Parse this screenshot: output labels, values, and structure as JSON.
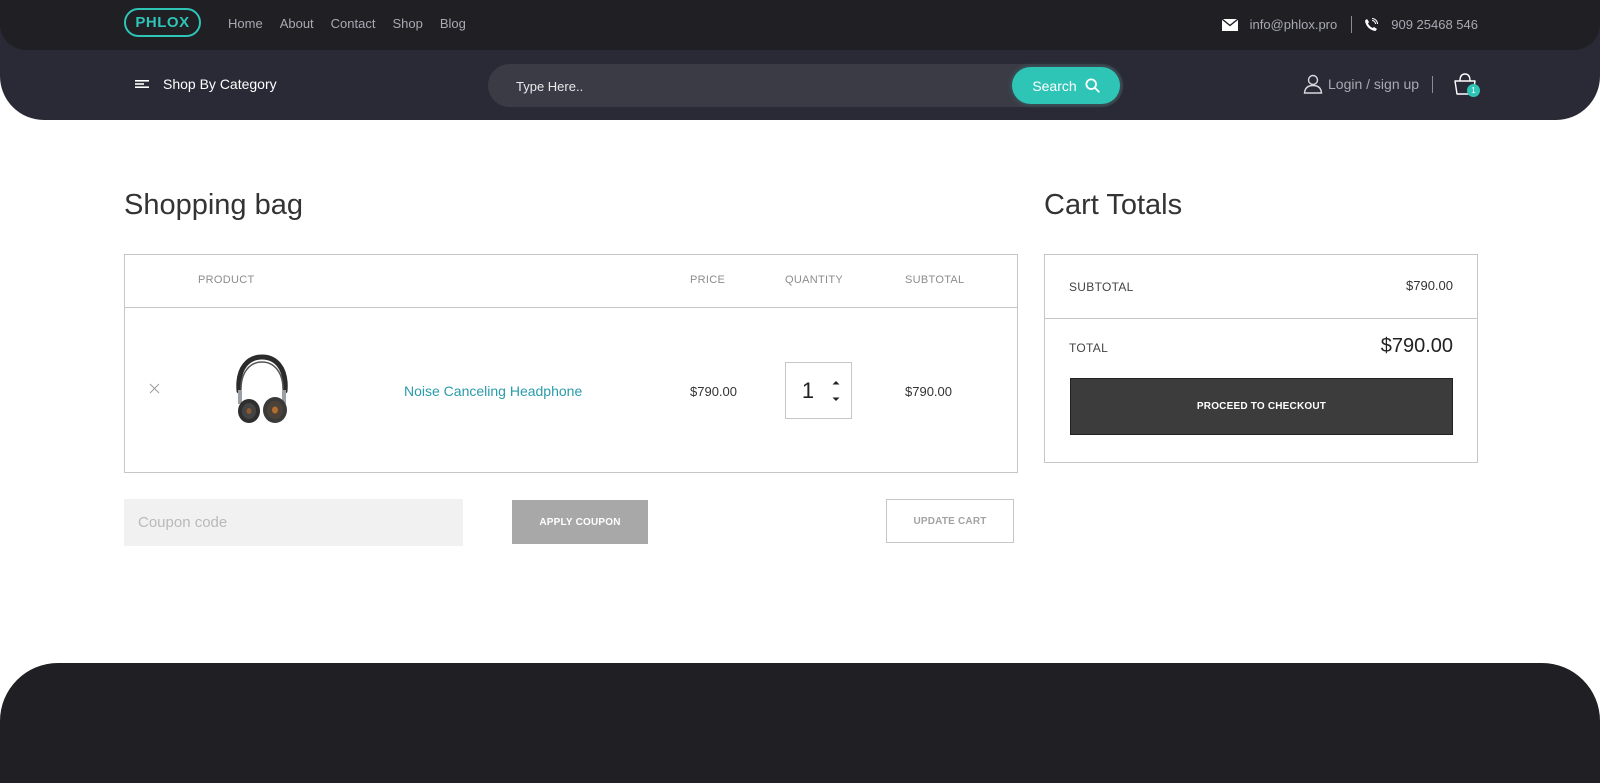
{
  "colors": {
    "accent": "#2ec4b6",
    "header_bg": "#2a2a36",
    "topbar_bg": "#1f1f24",
    "link": "#2a9bab",
    "checkout_bg": "#3c3c3c"
  },
  "header": {
    "logo": "PHLOX",
    "nav": [
      "Home",
      "About",
      "Contact",
      "Shop",
      "Blog"
    ],
    "email": "info@phlox.pro",
    "phone": "909 25468 546",
    "category_label": "Shop By Category",
    "search_placeholder": "Type Here..",
    "search_button": "Search",
    "login_label": "Login / sign up",
    "cart_count": "1"
  },
  "bag": {
    "title": "Shopping bag",
    "columns": {
      "product": "PRODUCT",
      "price": "PRICE",
      "quantity": "QUANTITY",
      "subtotal": "SUBTOTAL"
    },
    "items": [
      {
        "name": "Noise Canceling Headphone",
        "price": "$790.00",
        "quantity": "1",
        "subtotal": "$790.00"
      }
    ],
    "coupon_placeholder": "Coupon code",
    "apply_coupon": "APPLY COUPON",
    "update_cart": "UPDATE CART"
  },
  "totals": {
    "title": "Cart Totals",
    "subtotal_label": "SUBTOTAL",
    "subtotal_value": "$790.00",
    "total_label": "TOTAL",
    "total_value": "$790.00",
    "checkout": "PROCEED TO CHECKOUT"
  },
  "icons": [
    "menu-icon",
    "mail-icon",
    "phone-icon",
    "search-icon",
    "user-icon",
    "shopping-bag-icon",
    "close-icon",
    "chevron-up-icon",
    "chevron-down-icon",
    "headphone-image"
  ]
}
